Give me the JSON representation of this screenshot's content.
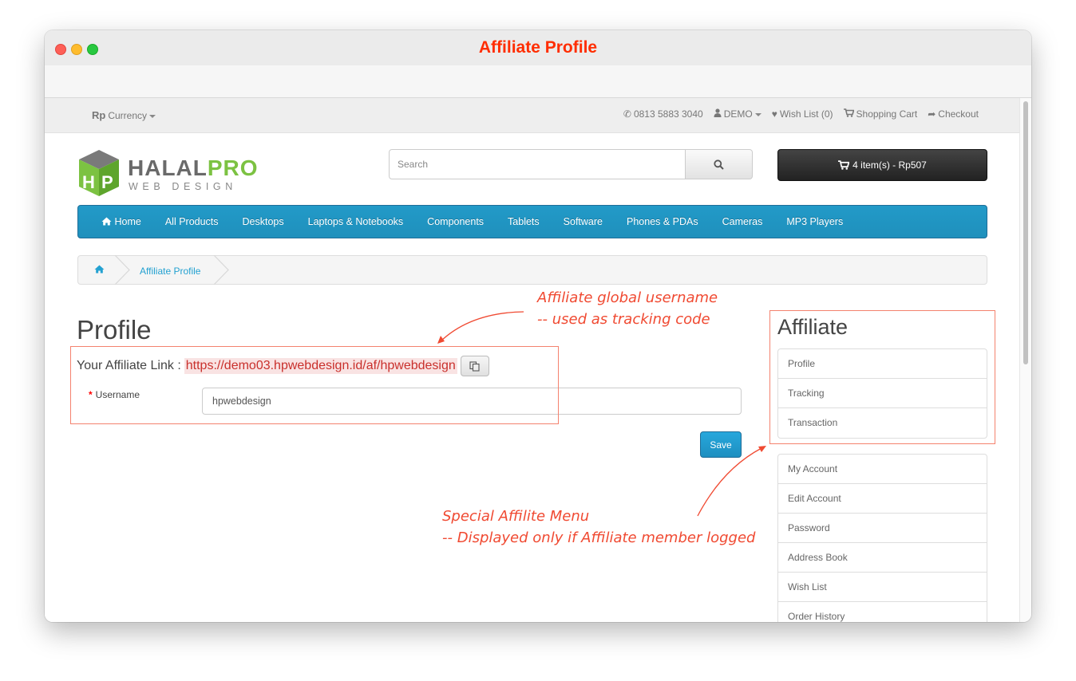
{
  "window": {
    "title": "Affiliate Profile"
  },
  "topbar": {
    "currency_symbol": "Rp",
    "currency_label": "Currency",
    "phone": "0813 5883 3040",
    "account": "DEMO",
    "wishlist": "Wish List (0)",
    "cart": "Shopping Cart",
    "checkout": "Checkout"
  },
  "header": {
    "logo_main": "HALAL",
    "logo_accent": "PRO",
    "logo_sub": "WEB DESIGN",
    "search_placeholder": "Search",
    "cart_total": "4 item(s) - Rp507"
  },
  "menu": {
    "home": "Home",
    "items": [
      "All Products",
      "Desktops",
      "Laptops & Notebooks",
      "Components",
      "Tablets",
      "Software",
      "Phones & PDAs",
      "Cameras",
      "MP3 Players"
    ]
  },
  "breadcrumb": {
    "current": "Affiliate Profile"
  },
  "main": {
    "heading": "Profile",
    "affiliate_link_label": "Your Affiliate Link :",
    "affiliate_link_url": "https://demo03.hpwebdesign.id/af/hpwebdesign",
    "username_label": "Username",
    "username_value": "hpwebdesign",
    "save_label": "Save"
  },
  "sidebar": {
    "heading": "Affiliate",
    "affiliate_items": [
      "Profile",
      "Tracking",
      "Transaction"
    ],
    "account_items": [
      "My Account",
      "Edit Account",
      "Password",
      "Address Book",
      "Wish List",
      "Order History"
    ]
  },
  "annotations": {
    "top_line1": "Affiliate global username",
    "top_line2": "-- used as tracking code",
    "bottom_line1": "Special Affilite Menu",
    "bottom_line2": "-- Displayed only if Affiliate member logged"
  },
  "colors": {
    "accent": "#229ac8",
    "annotation": "#f04a32",
    "title": "#ff2d00"
  }
}
